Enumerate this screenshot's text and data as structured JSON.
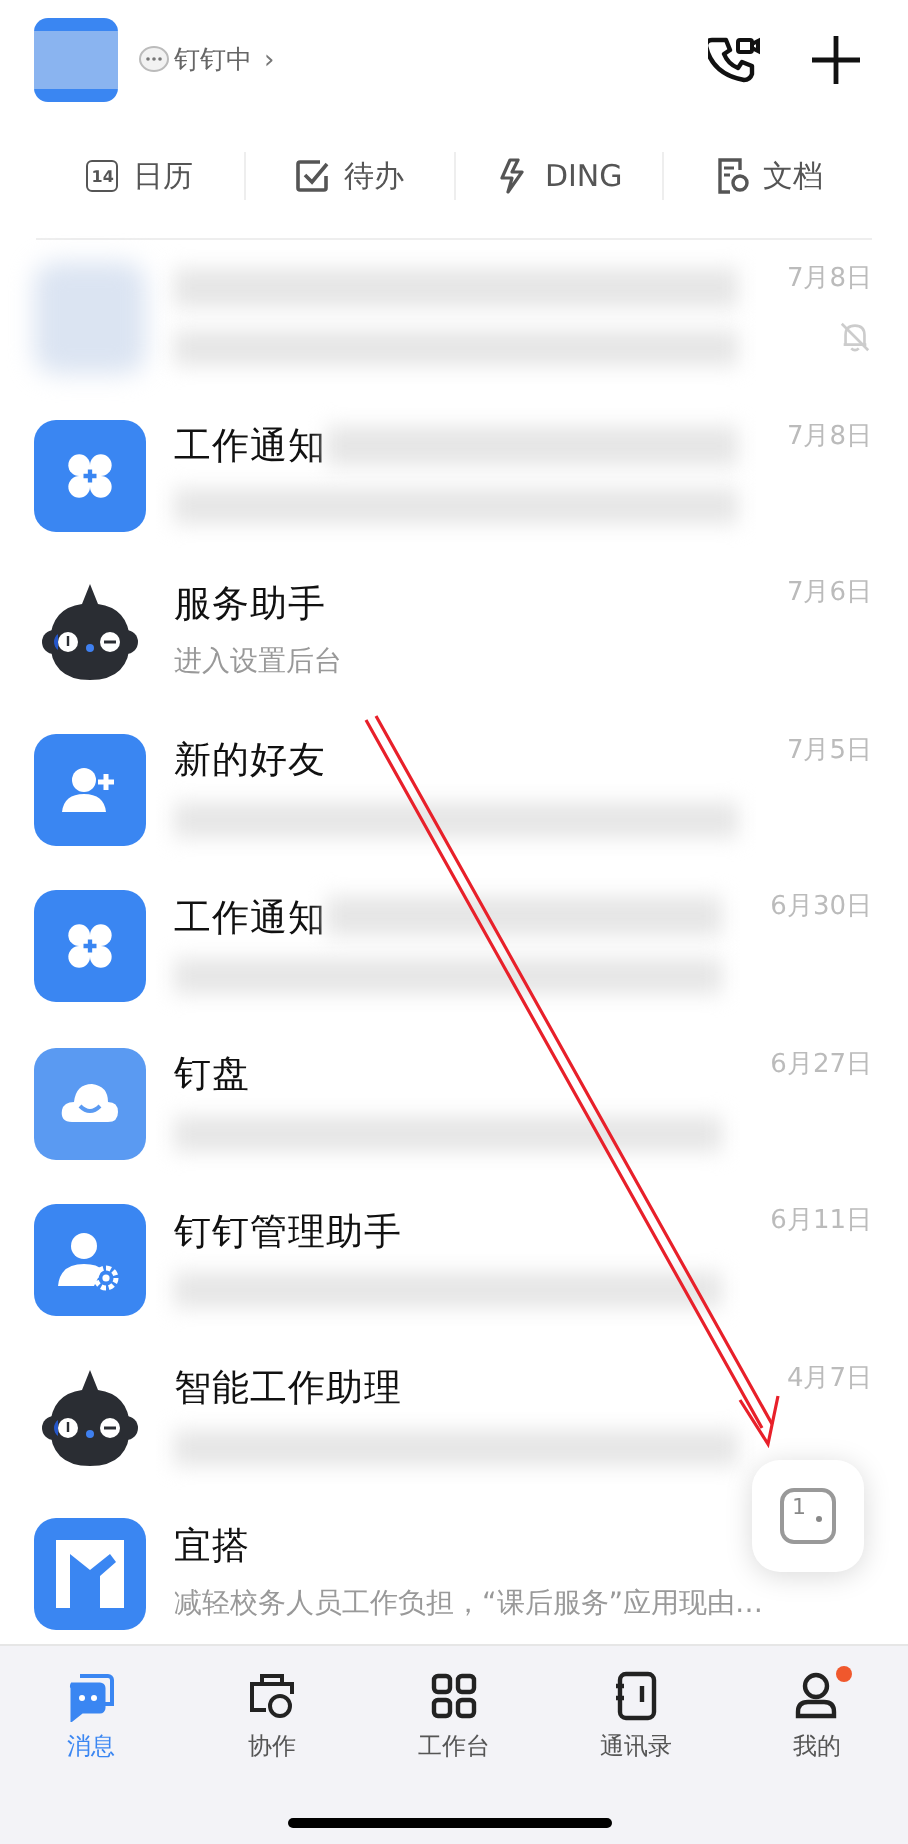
{
  "header": {
    "status": "钉钉中",
    "chevron": "›"
  },
  "quick_actions": [
    {
      "kind": "calendar",
      "icon_text": "14",
      "label": "日历"
    },
    {
      "kind": "todo",
      "label": "待办"
    },
    {
      "kind": "ding",
      "label": "DING"
    },
    {
      "kind": "docs",
      "label": "文档"
    }
  ],
  "chats": [
    {
      "kind": "blurred",
      "title_redacted": true,
      "preview_redacted": true,
      "time": "7月8日",
      "muted": true
    },
    {
      "kind": "grid",
      "title": "工作通知",
      "title_redacted": true,
      "preview_redacted": true,
      "time": "7月8日",
      "muted": false
    },
    {
      "kind": "bot",
      "title": "服务助手",
      "preview": "进入设置后台",
      "title_redacted": false,
      "preview_redacted": false,
      "time": "7月6日",
      "muted": false
    },
    {
      "kind": "person-add",
      "title": "新的好友",
      "title_redacted": false,
      "preview_redacted": true,
      "time": "7月5日",
      "muted": false
    },
    {
      "kind": "grid",
      "title": "工作通知",
      "title_redacted": true,
      "preview_redacted": true,
      "time": "6月30日",
      "muted": false
    },
    {
      "kind": "cloud",
      "title": "钉盘",
      "title_redacted": false,
      "preview_redacted": true,
      "time": "6月27日",
      "muted": false
    },
    {
      "kind": "person-gear",
      "title": "钉钉管理助手",
      "title_redacted": false,
      "preview_redacted": true,
      "time": "6月11日",
      "muted": false
    },
    {
      "kind": "bot",
      "title": "智能工作助理",
      "title_redacted": false,
      "preview_redacted": true,
      "time": "4月7日",
      "muted": false
    },
    {
      "kind": "yida",
      "title": "宜搭",
      "preview": "减轻校务人员工作负担，“课后服务”应用现由…",
      "title_redacted": false,
      "preview_redacted": false,
      "muted": false
    }
  ],
  "floating_button": {
    "label": "1"
  },
  "tabs": [
    {
      "kind": "messages",
      "label": "消息",
      "selected": true,
      "badge": false
    },
    {
      "kind": "collab",
      "label": "协作",
      "selected": false,
      "badge": false
    },
    {
      "kind": "workbench",
      "label": "工作台",
      "selected": false,
      "badge": false
    },
    {
      "kind": "contacts",
      "label": "通讯录",
      "selected": false,
      "badge": false
    },
    {
      "kind": "me",
      "label": "我的",
      "selected": false,
      "badge": true
    }
  ]
}
